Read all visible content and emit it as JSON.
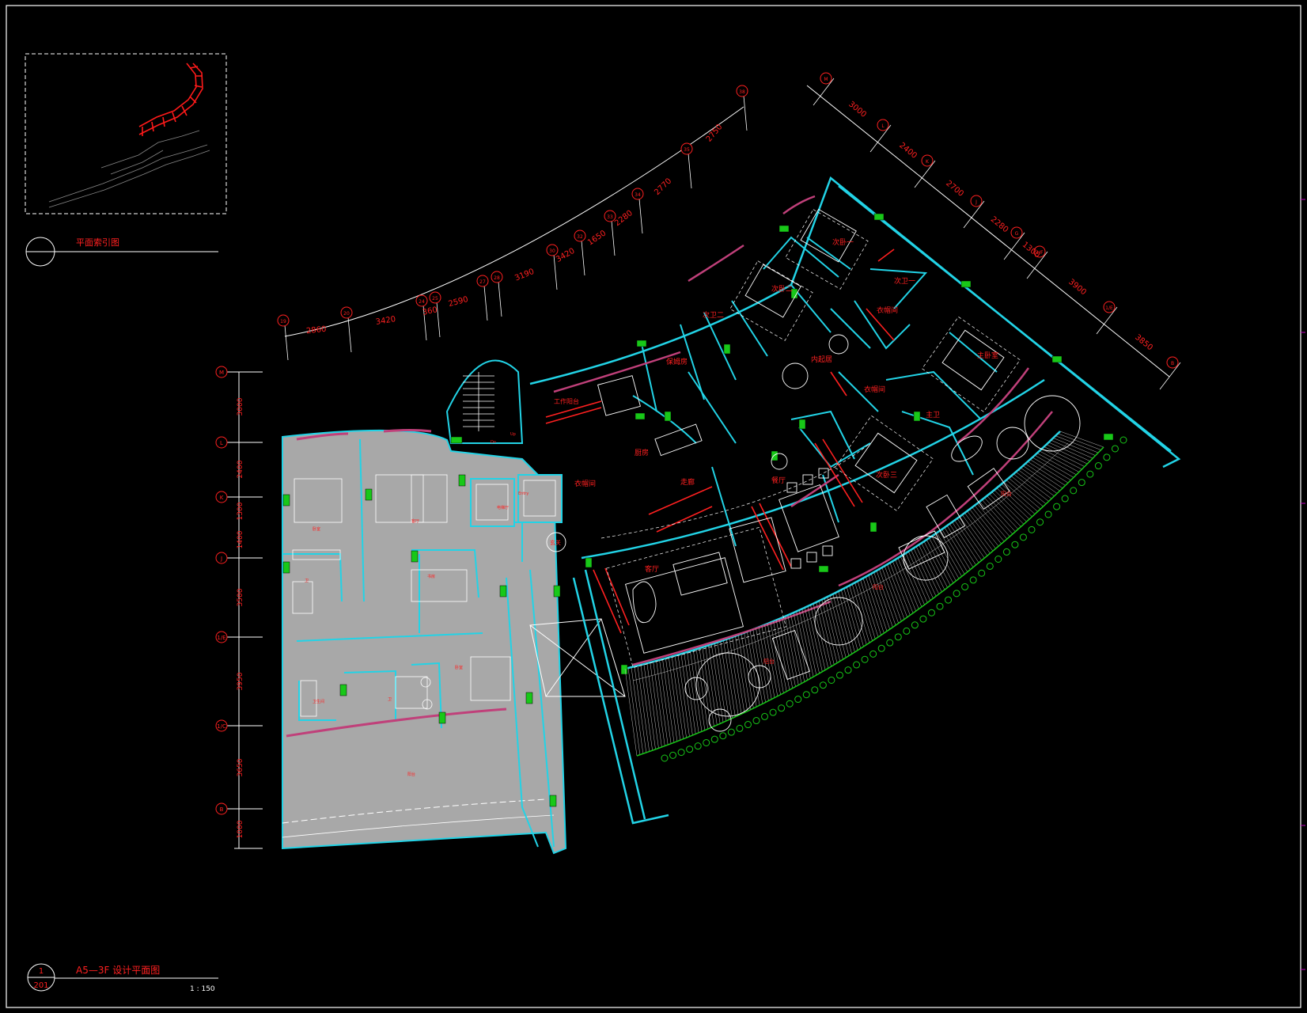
{
  "colors": {
    "background": "#000000",
    "frame": "#ffffff",
    "dim": "#ffffff",
    "label": "#ff2020",
    "wall": "#22d3e6",
    "column": "#18c818",
    "pink": "#c0407a",
    "furniture": "#ffffff",
    "grey_area": "#a8a8a8",
    "keyplan_red": "#ff1a1a"
  },
  "keyplan": {
    "title": "平面索引图"
  },
  "title_block": {
    "sheet_number": "1",
    "drawing_number": "201",
    "title": "A5—3F 设计平面图",
    "scale": "1 : 150"
  },
  "left_axis": {
    "labels": [
      "M",
      "L",
      "K",
      "J",
      "1/E",
      "1/C",
      "B"
    ],
    "dims": [
      "3000",
      "2400",
      "1300",
      "1400",
      "3500",
      "3950",
      "3650",
      "1000"
    ]
  },
  "top_arc_axis": {
    "labels": [
      "19",
      "20",
      "24",
      "25",
      "27",
      "28",
      "30",
      "32",
      "33",
      "34",
      "35",
      "38"
    ],
    "dims": [
      "2860",
      "3420",
      "360",
      "2590",
      "3190",
      "3420",
      "1650",
      "2280",
      "2770",
      "2750"
    ]
  },
  "right_axis": {
    "labels": [
      "M",
      "L",
      "K",
      "J",
      "G",
      "1/F",
      "1/E",
      "B"
    ],
    "dims": [
      "3000",
      "2400",
      "2700",
      "2280",
      "1300",
      "3900",
      "3850"
    ]
  },
  "rooms": [
    {
      "id": "ciwo1",
      "label": "次卧一"
    },
    {
      "id": "ciwo2",
      "label": "次卧二"
    },
    {
      "id": "ciwei1",
      "label": "次卫一"
    },
    {
      "id": "ciwei2",
      "label": "次卫二"
    },
    {
      "id": "yimaojian1",
      "label": "衣帽间"
    },
    {
      "id": "yimaojian2",
      "label": "衣帽间"
    },
    {
      "id": "yimaojian3",
      "label": "衣帽间"
    },
    {
      "id": "neiqijian",
      "label": "内起居"
    },
    {
      "id": "zhuwoshi",
      "label": "主卧室"
    },
    {
      "id": "zhuwei",
      "label": "主卫"
    },
    {
      "id": "ciwo3",
      "label": "次卧三"
    },
    {
      "id": "baomufang",
      "label": "保姆房"
    },
    {
      "id": "chufang",
      "label": "厨房"
    },
    {
      "id": "zouliang",
      "label": "走廊"
    },
    {
      "id": "canting",
      "label": "餐厅"
    },
    {
      "id": "keting",
      "label": "客厅"
    },
    {
      "id": "yangtai1",
      "label": "阳台"
    },
    {
      "id": "yangtai2",
      "label": "阳台"
    },
    {
      "id": "yangtai3",
      "label": "阳台"
    },
    {
      "id": "gongzuo",
      "label": "工作阳台"
    },
    {
      "id": "diantingjian",
      "label": "电梯厅"
    },
    {
      "id": "xuanguan",
      "label": "玄关"
    }
  ]
}
